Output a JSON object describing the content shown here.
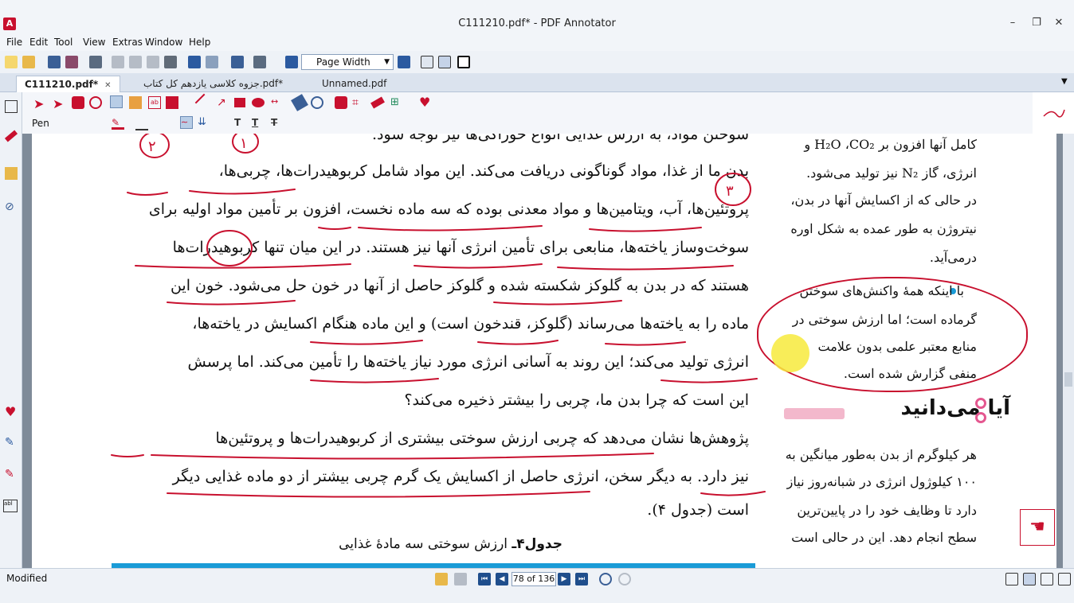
{
  "window": {
    "title": "C111210.pdf* - PDF Annotator",
    "minimize": "–",
    "maximize": "❐",
    "close": "✕"
  },
  "menu": [
    "File",
    "Edit",
    "Tool",
    "View",
    "Extras",
    "Window",
    "Help"
  ],
  "toolbar": {
    "zoom_value": "Page Width"
  },
  "tabs": [
    {
      "label": "C111210.pdf*",
      "active": true
    },
    {
      "label": "جزوه کلاسی یازدهم کل کتاب.pdf*",
      "active": false
    },
    {
      "label": "Unnamed.pdf",
      "active": false
    }
  ],
  "ann_toolbar": {
    "tool_label": "Pen"
  },
  "document": {
    "main_lines": [
      "سوختن مواد، به ارزش غذایی انواع خوراکی‌ها نیز توجه شود.",
      "بدن ما از غذا، مواد گوناگونی دریافت می‌کند. این مواد شامل کربوهیدرات‌ها، چربی‌ها،",
      "پروتئین‌ها، آب، ویتامین‌ها و مواد معدنی بوده که سه ماده نخست، افزون بر تأمین مواد اولیه برای",
      "سوخت‌وساز یاخته‌ها، منابعی برای تأمین انرژی آنها نیز هستند. در این میان تنها کربوهیدرات‌ها",
      "هستند که در بدن به گلوکز شکسته شده و گلوکز حاصل از آنها در خون حل می‌شود. خون این",
      "ماده را به یاخته‌ها می‌رساند (گلوکز، قندخون است) و این ماده هنگام اکسایش در یاخته‌ها،",
      "انرژی تولید می‌کند؛ این روند به آسانی انرژی مورد نیاز یاخته‌ها را تأمین می‌کند. اما پرسش",
      "این است که چرا بدن ما، چربی را بیشتر ذخیره می‌کند؟",
      "پژوهش‌ها نشان می‌دهد که چربی ارزش سوختی بیشتری از کربوهیدرات‌ها و پروتئین‌ها",
      "نیز دارد. به دیگر سخن، انرژی حاصل از اکسایش یک گرم چربی بیشتر از دو ماده غذایی دیگر",
      "است (جدول ۴)."
    ],
    "side_lines": [
      "کامل آنها افزون بر H₂O ،CO₂ و",
      "انرژی، گاز N₂ نیز تولید می‌شود.",
      "در حالی که از اکسایش آنها در بدن،",
      "نیتروژن به طور عمده به شکل اوره",
      "درمی‌آید."
    ],
    "box_lines": [
      "با اینکه همهٔ واکنش‌های سوختن",
      "گرماده است؛ اما ارزش سوختی در",
      "منابع معتبر علمی بدون علامت",
      "منفی گزارش شده است."
    ],
    "didyou_title": "آیا می‌دانید",
    "didyou_lines": [
      "هر کیلوگرم از بدن به‌طور میانگین به",
      "۱۰۰ کیلوژول انرژی در شبانه‌روز نیاز",
      "دارد تا وظایف خود را در پایین‌ترین",
      "سطح انجام دهد. این در حالی است"
    ],
    "caption_bold": "جدول۴ـ",
    "caption_text": " ارزش سوختی سه مادهٔ غذایی",
    "handwritten_numbers": [
      "۲",
      "۱",
      "۳"
    ]
  },
  "status": {
    "state": "Modified",
    "page_indicator": "78 of 136"
  },
  "colors": {
    "ink": "#c8102e",
    "accent": "#1f4e8c",
    "table_header": "#1a9bd7",
    "highlight": "#f7ea3c"
  }
}
